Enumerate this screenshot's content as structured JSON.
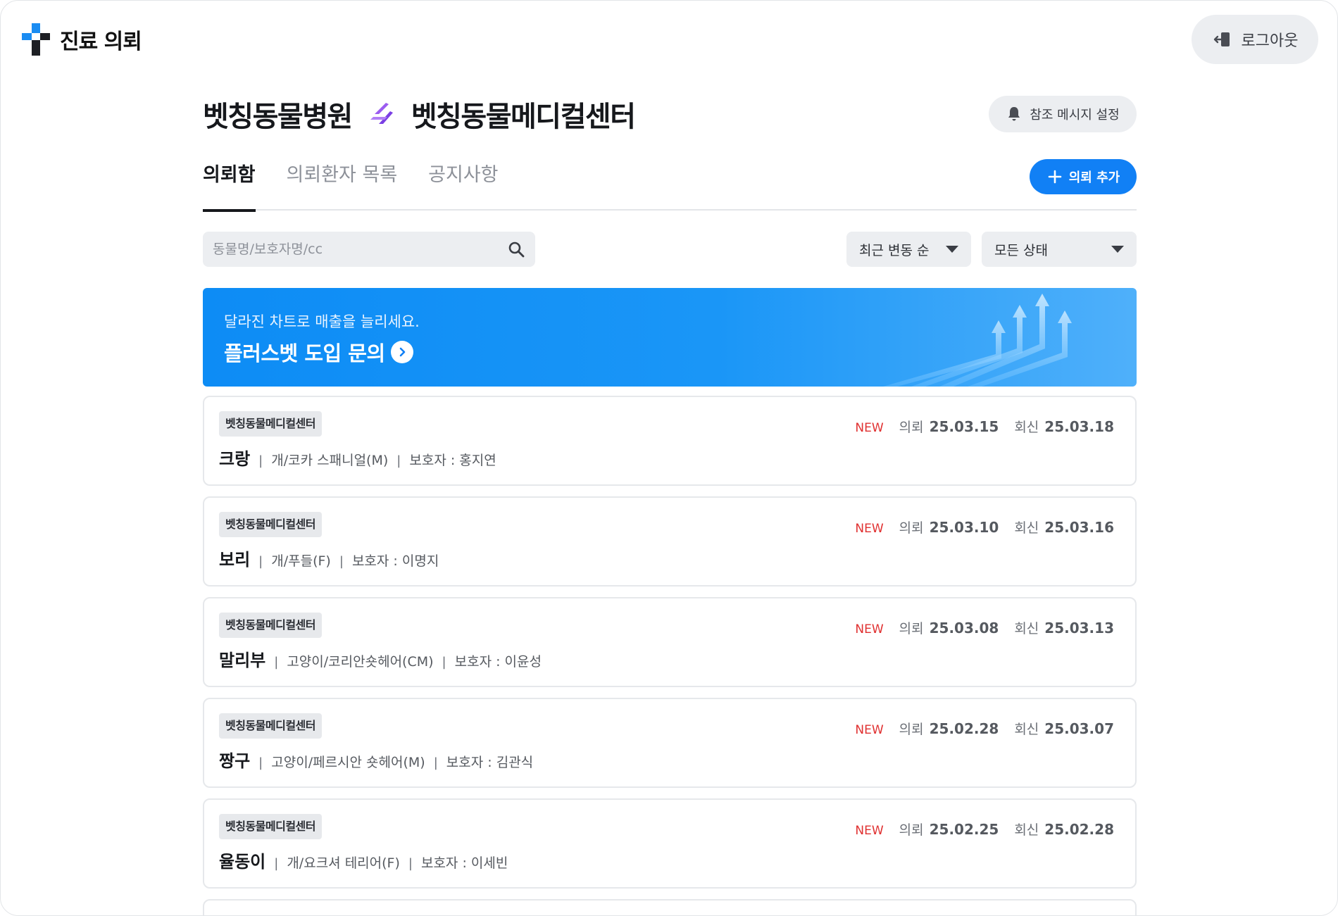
{
  "app": {
    "logo_text": "진료 의뢰",
    "logout_label": "로그아웃"
  },
  "header": {
    "hospital_from": "벳칭동물병원",
    "hospital_to": "벳칭동물메디컬센터",
    "ref_message_label": "참조 메시지 설정"
  },
  "tabs": [
    {
      "label": "의뢰함",
      "active": true
    },
    {
      "label": "의뢰환자 목록",
      "active": false
    },
    {
      "label": "공지사항",
      "active": false
    }
  ],
  "add_button_label": "의뢰 추가",
  "search": {
    "placeholder": "동물명/보호자명/cc",
    "value": ""
  },
  "filters": {
    "sort_selected": "최근 변동 순",
    "status_selected": "모든 상태"
  },
  "banner": {
    "subtitle": "달라진 차트로 매출을 늘리세요.",
    "cta": "플러스벳 도입 문의"
  },
  "labels": {
    "request": "의뢰",
    "reply": "회신"
  },
  "referrals": [
    {
      "badge": "벳칭동물메디컬센터",
      "name": "크랑",
      "species": "개/코카 스패니얼(M)",
      "guardian": "보호자 : 홍지연",
      "new": "NEW",
      "requested": "25.03.15",
      "replied": "25.03.18"
    },
    {
      "badge": "벳칭동물메디컬센터",
      "name": "보리",
      "species": "개/푸들(F)",
      "guardian": "보호자 : 이명지",
      "new": "NEW",
      "requested": "25.03.10",
      "replied": "25.03.16"
    },
    {
      "badge": "벳칭동물메디컬센터",
      "name": "말리부",
      "species": "고양이/코리안숏헤어(CM)",
      "guardian": "보호자 : 이윤성",
      "new": "NEW",
      "requested": "25.03.08",
      "replied": "25.03.13"
    },
    {
      "badge": "벳칭동물메디컬센터",
      "name": "짱구",
      "species": "고양이/페르시안 숏헤어(M)",
      "guardian": "보호자 : 김관식",
      "new": "NEW",
      "requested": "25.02.28",
      "replied": "25.03.07"
    },
    {
      "badge": "벳칭동물메디컬센터",
      "name": "율동이",
      "species": "개/요크셔 테리어(F)",
      "guardian": "보호자 : 이세빈",
      "new": "NEW",
      "requested": "25.02.25",
      "replied": "25.02.28"
    }
  ],
  "colors": {
    "primary": "#1180f5",
    "new_red": "#e03131",
    "logo_blue": "#1a8cf2",
    "logo_dark": "#1d1f24",
    "transfer_icon": "#7b3fe4"
  }
}
